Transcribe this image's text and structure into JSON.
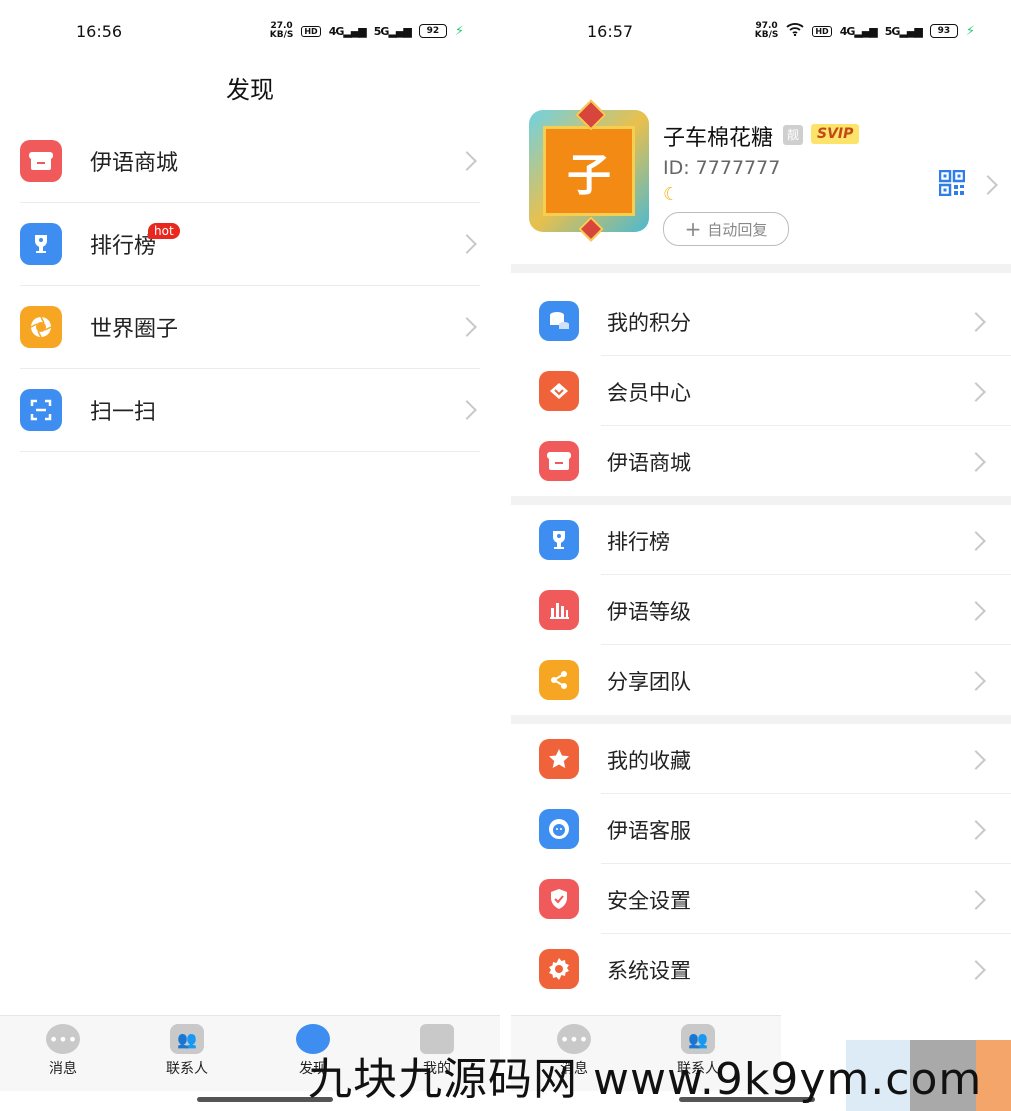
{
  "left": {
    "status": {
      "time": "16:56",
      "speed": "27.0",
      "speed_unit": "KB/S",
      "hd": "HD",
      "net1": "4G",
      "net2": "5G",
      "battery": "92"
    },
    "title": "发现",
    "items": [
      {
        "label": "伊语商城",
        "icon": "store-icon",
        "color": "#f05a5a"
      },
      {
        "label": "排行榜",
        "icon": "trophy-icon",
        "color": "#3d8ef0",
        "badge": "hot"
      },
      {
        "label": "世界圈子",
        "icon": "aperture-icon",
        "color": "#f6a623"
      },
      {
        "label": "扫一扫",
        "icon": "scan-icon",
        "color": "#3d8ef0"
      }
    ],
    "tabs": [
      "消息",
      "联系人",
      "发现",
      "我的"
    ]
  },
  "right": {
    "status": {
      "time": "16:57",
      "speed": "97.0",
      "speed_unit": "KB/S",
      "hd": "HD",
      "net1": "4G",
      "net2": "5G",
      "battery": "93"
    },
    "profile": {
      "avatar_char": "子",
      "name": "子车棉花糖",
      "badge": "靓",
      "vip": "SVIP",
      "id": "ID: 7777777",
      "auto_reply": "自动回复"
    },
    "groups": [
      [
        {
          "label": "我的积分",
          "icon": "coins-icon",
          "color": "#3d8ef0"
        },
        {
          "label": "会员中心",
          "icon": "diamond-icon",
          "color": "#f0633a"
        },
        {
          "label": "伊语商城",
          "icon": "store-icon",
          "color": "#f05a5a"
        }
      ],
      [
        {
          "label": "排行榜",
          "icon": "trophy-icon",
          "color": "#3d8ef0"
        },
        {
          "label": "伊语等级",
          "icon": "bar-chart-icon",
          "color": "#f05a5a"
        },
        {
          "label": "分享团队",
          "icon": "share-icon",
          "color": "#f6a623"
        }
      ],
      [
        {
          "label": "我的收藏",
          "icon": "star-icon",
          "color": "#f0633a"
        },
        {
          "label": "伊语客服",
          "icon": "support-icon",
          "color": "#3d8ef0"
        },
        {
          "label": "安全设置",
          "icon": "shield-icon",
          "color": "#f05a5a"
        },
        {
          "label": "系统设置",
          "icon": "gear-icon",
          "color": "#f0633a"
        }
      ]
    ],
    "tabs": [
      "消息",
      "联系人"
    ]
  },
  "watermark": "九块九源码网 www.9k9ym.com"
}
